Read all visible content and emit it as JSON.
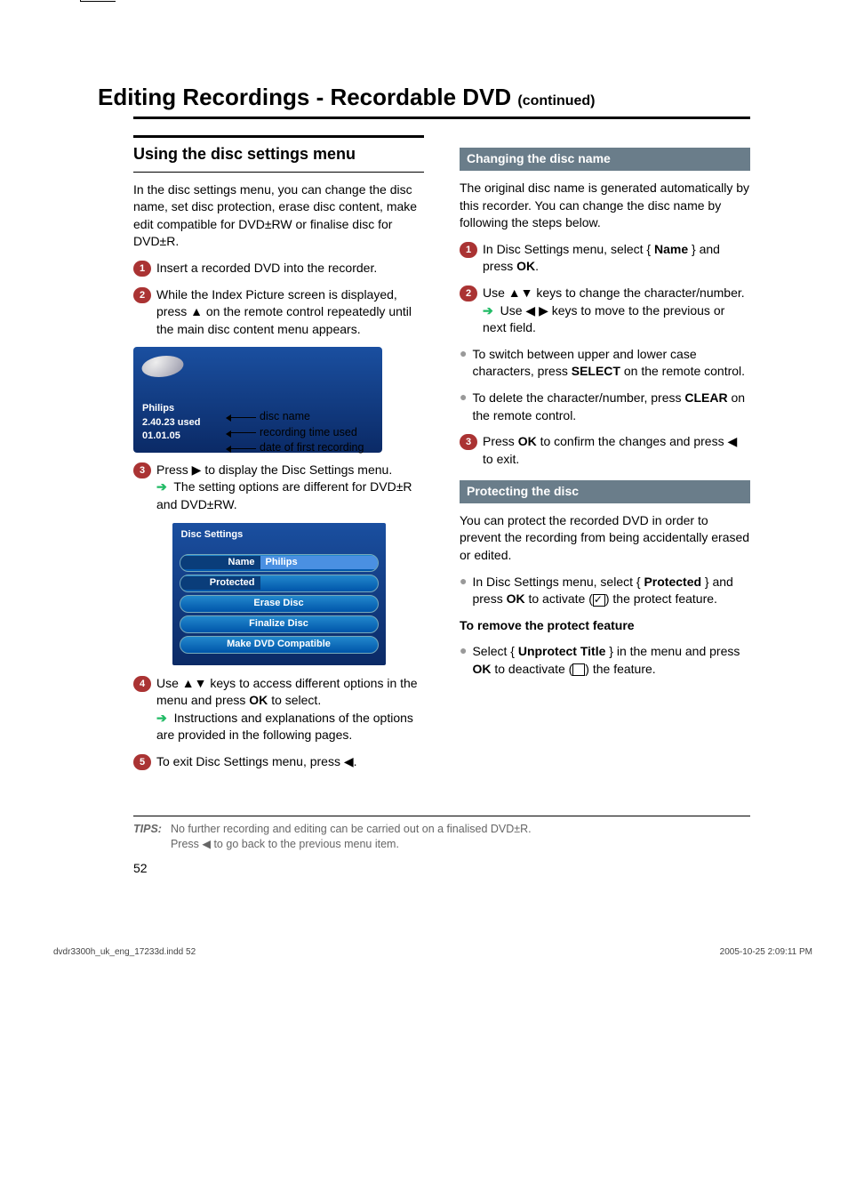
{
  "title": "Editing Recordings - Recordable DVD",
  "title_cont": "(continued)",
  "left": {
    "section_head": "Using the disc settings menu",
    "intro": "In the disc settings menu, you can change the disc name, set disc protection, erase disc content, make edit compatible for DVD±RW or finalise disc for DVD±R.",
    "step1": "Insert a recorded DVD into the recorder.",
    "step2": "While the Index Picture screen is displayed, press ▲ on the remote control repeatedly until the main disc content menu appears.",
    "ss1": {
      "line1": "Philips",
      "line2": "2.40.23 used",
      "line3": "01.01.05",
      "call1": "disc name",
      "call2": "recording time used",
      "call3": "date of first recording"
    },
    "step3_a": "Press ▶ to display the Disc Settings menu.",
    "step3_b": "The setting options are different for DVD±R and DVD±RW.",
    "panel": {
      "title": "Disc Settings",
      "name_lbl": "Name",
      "name_val": "Philips",
      "protected_lbl": "Protected",
      "erase": "Erase Disc",
      "finalize": "Finalize Disc",
      "make": "Make DVD Compatible"
    },
    "step4_a": "Use ▲▼ keys to access different options in the menu and press",
    "step4_ok": "OK",
    "step4_b": "to select.",
    "step4_c": "Instructions and explanations of the options are provided in the following pages.",
    "step5": "To exit Disc Settings menu, press ◀."
  },
  "right": {
    "change_head": "Changing the disc name",
    "change_intro": "The original disc name is generated automatically by this recorder. You can change the disc name by following the steps below.",
    "c1_a": "In Disc Settings menu, select {",
    "c1_name": "Name",
    "c1_b": "} and press",
    "c1_ok": "OK",
    "c2_a": "Use ▲▼ keys to change the character/number.",
    "c2_b": "Use ◀ ▶ keys to move to the previous or next field.",
    "cb1_a": "To switch between upper and lower case characters, press",
    "cb1_select": "SELECT",
    "cb1_b": "on the remote control.",
    "cb2_a": "To delete the character/number, press",
    "cb2_clear": "CLEAR",
    "cb2_b": "on the remote control.",
    "c3_a": "Press",
    "c3_ok": "OK",
    "c3_b": "to confirm the changes and press ◀ to exit.",
    "protect_head": "Protecting the disc",
    "protect_intro": "You can protect the recorded DVD in order to prevent the recording from being accidentally erased or edited.",
    "pb1_a": "In Disc Settings menu, select {",
    "pb1_protected": "Protected",
    "pb1_b": "} and press",
    "pb1_ok": "OK",
    "pb1_c": "to activate (",
    "pb1_d": ") the protect feature.",
    "remove_head": "To remove the protect feature",
    "rb_a": "Select {",
    "rb_unprotect": "Unprotect Title",
    "rb_b": "} in the menu and press",
    "rb_ok": "OK",
    "rb_c": "to deactivate (",
    "rb_d": ") the feature."
  },
  "tips_lbl": "TIPS:",
  "tips_body1": "No further recording and editing can be carried out on a finalised DVD±R.",
  "tips_body2": "Press ◀ to go back to the previous menu item.",
  "page_num": "52",
  "footer_left": "dvdr3300h_uk_eng_17233d.indd   52",
  "footer_right": "2005-10-25   2:09:11 PM"
}
